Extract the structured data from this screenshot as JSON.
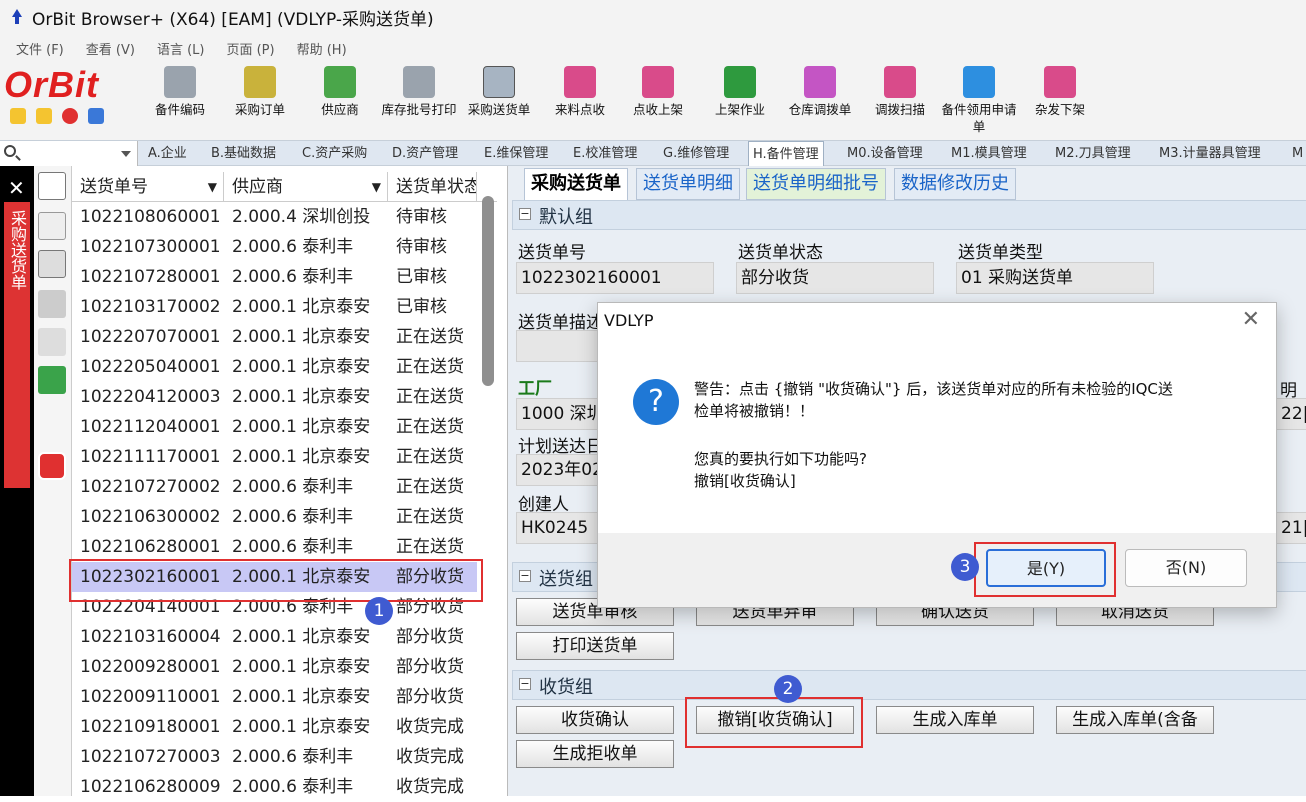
{
  "window": {
    "title": "OrBit Browser+ (X64) [EAM] (VDLYP-采购送货单)"
  },
  "menu": [
    "文件 (F)",
    "查看 (V)",
    "语言 (L)",
    "页面 (P)",
    "帮助 (H)"
  ],
  "logo": "OrBit",
  "toolbar": [
    {
      "label": "备件编码",
      "icon": "scanner-icon"
    },
    {
      "label": "采购订单",
      "icon": "cart-icon"
    },
    {
      "label": "供应商",
      "icon": "supplier-icon"
    },
    {
      "label": "库存批号打印",
      "icon": "print-scanner-icon"
    },
    {
      "label": "采购送货单",
      "icon": "delivery-icon"
    },
    {
      "label": "来料点收",
      "icon": "cubes-icon"
    },
    {
      "label": "点收上架",
      "icon": "cubes-icon"
    },
    {
      "label": "上架作业",
      "icon": "grid-arrow-icon"
    },
    {
      "label": "仓库调拨单",
      "icon": "transfer-icon"
    },
    {
      "label": "调拨扫描",
      "icon": "cubes-icon"
    },
    {
      "label": "备件领用申请单",
      "icon": "book-icon"
    },
    {
      "label": "杂发下架",
      "icon": "cubes-icon"
    }
  ],
  "module_tabs": [
    "A.企业",
    "B.基础数据",
    "C.资产采购",
    "D.资产管理",
    "E.维保管理",
    "E.校准管理",
    "G.维修管理",
    "H.备件管理",
    "M0.设备管理",
    "M1.模具管理",
    "M2.刀具管理",
    "M3.计量器具管理",
    "M"
  ],
  "active_module": "H.备件管理",
  "side_tab": "采购送货单",
  "list": {
    "headers": [
      "送货单号",
      "供应商",
      "送货单状态"
    ],
    "rows": [
      [
        "1022108060001",
        "2.000.4 深圳创投",
        "待审核"
      ],
      [
        "1022107300001",
        "2.000.6 泰利丰",
        "待审核"
      ],
      [
        "1022107280001",
        "2.000.6 泰利丰",
        "已审核"
      ],
      [
        "1022103170002",
        "2.000.1 北京泰安",
        "已审核"
      ],
      [
        "1022207070001",
        "2.000.1 北京泰安",
        "正在送货"
      ],
      [
        "1022205040001",
        "2.000.1 北京泰安",
        "正在送货"
      ],
      [
        "1022204120003",
        "2.000.1 北京泰安",
        "正在送货"
      ],
      [
        "1022112040001",
        "2.000.1 北京泰安",
        "正在送货"
      ],
      [
        "1022111170001",
        "2.000.1 北京泰安",
        "正在送货"
      ],
      [
        "1022107270002",
        "2.000.6 泰利丰",
        "正在送货"
      ],
      [
        "1022106300002",
        "2.000.6 泰利丰",
        "正在送货"
      ],
      [
        "1022106280001",
        "2.000.6 泰利丰",
        "正在送货"
      ],
      [
        "1022302160001",
        "2.000.1 北京泰安",
        "部分收货"
      ],
      [
        "1022204140001",
        "2.000.6 泰利丰",
        "部分收货"
      ],
      [
        "1022103160004",
        "2.000.1 北京泰安",
        "部分收货"
      ],
      [
        "1022009280001",
        "2.000.1 北京泰安",
        "部分收货"
      ],
      [
        "1022009110001",
        "2.000.1 北京泰安",
        "部分收货"
      ],
      [
        "1022109180001",
        "2.000.1 北京泰安",
        "收货完成"
      ],
      [
        "1022107270003",
        "2.000.6 泰利丰",
        "收货完成"
      ],
      [
        "1022106280009",
        "2.000.6 泰利丰",
        "收货完成"
      ]
    ],
    "selected_row": 12
  },
  "form_tabs": [
    "采购送货单",
    "送货单明细",
    "送货单明细批号",
    "数据修改历史"
  ],
  "groups": {
    "default": "默认组",
    "delivery": "送货组",
    "receive": "收货组"
  },
  "fields": {
    "no_label": "送货单号",
    "no_value": "1022302160001",
    "status_label": "送货单状态",
    "status_value": "部分收货",
    "type_label": "送货单类型",
    "type_value": "01 采购送货单",
    "desc_label": "送货单描述",
    "plant_label": "工厂",
    "plant_value": "1000 深圳",
    "plan_label": "计划送达日",
    "plan_value": "2023年02",
    "creator_label": "创建人",
    "creator_value": "HK0245",
    "right_label_frag": "明",
    "right_val1_frag": "22|",
    "right_val2_frag": "21|"
  },
  "delivery_buttons": [
    "送货单审核",
    "送货单弃审",
    "确认送货",
    "取消送货",
    "打印送货单"
  ],
  "receive_buttons": [
    "收货确认",
    "撤销[收货确认]",
    "生成入库单",
    "生成入库单(含备",
    "生成拒收单"
  ],
  "badges": [
    "1",
    "2",
    "3"
  ],
  "dialog": {
    "title": "VDLYP",
    "line1": "警告：点击 {撤销 \"收货确认\"} 后，该送货单对应的所有未检验的IQC送",
    "line2": "检单将被撤销！！",
    "line3": "您真的要执行如下功能吗?",
    "line4": "撤销[收货确认]",
    "yes": "是(Y)",
    "no": "否(N)"
  },
  "colors": {
    "accent": "#e03030",
    "badge": "#3f5bd1",
    "selected_row": "#c8c8f5",
    "logo": "#e02020"
  }
}
